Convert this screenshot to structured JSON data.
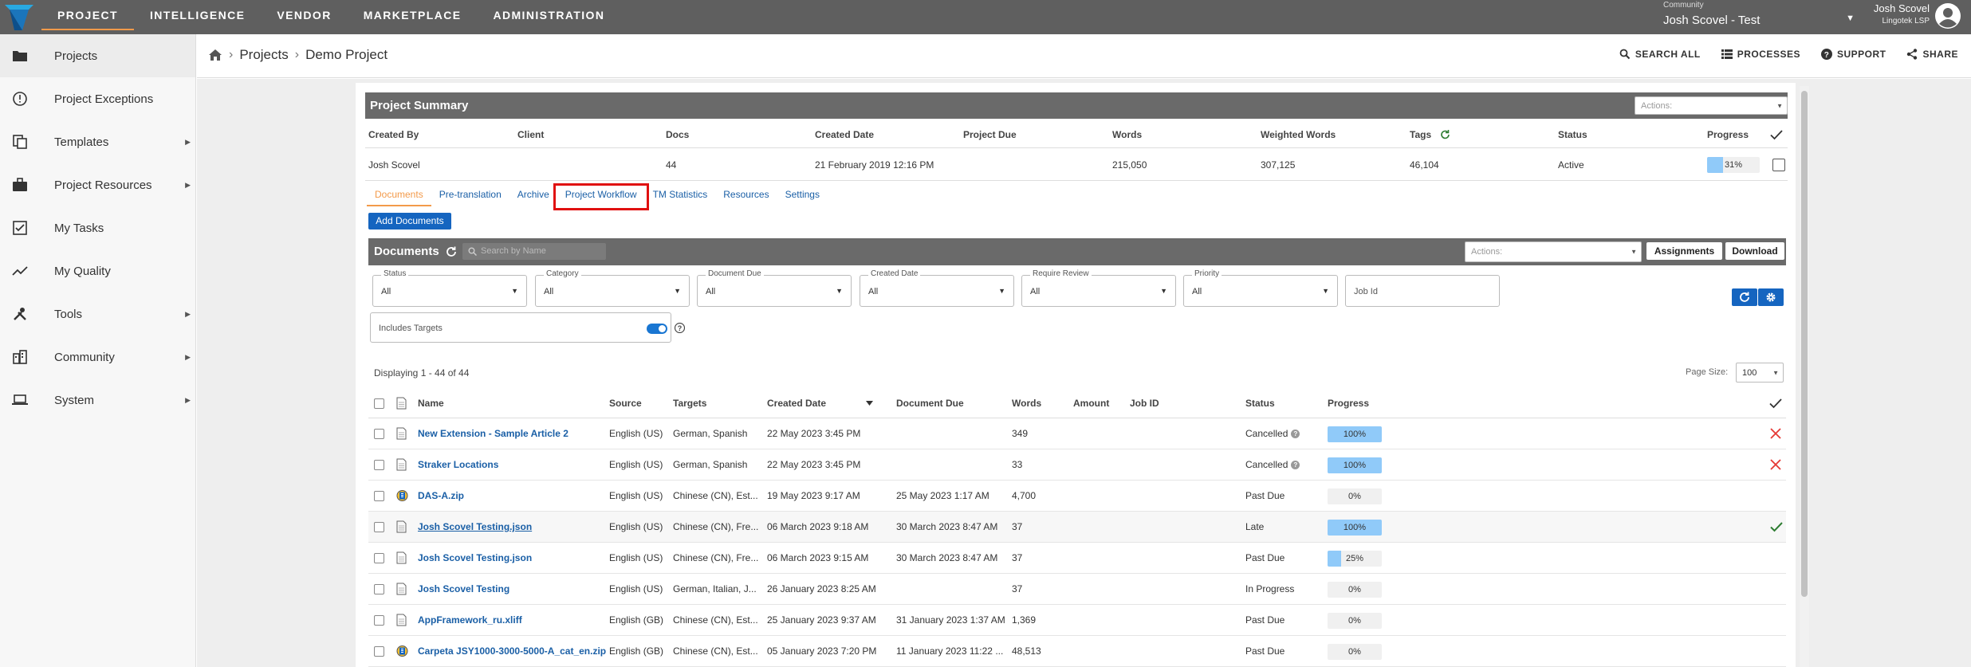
{
  "topnav": {
    "items": [
      "PROJECT",
      "INTELLIGENCE",
      "VENDOR",
      "MARKETPLACE",
      "ADMINISTRATION"
    ],
    "active_index": 0,
    "community_label": "Community",
    "community_value": "Josh Scovel - Test",
    "user_name": "Josh Scovel",
    "user_org": "Lingotek LSP"
  },
  "sidebar": {
    "items": [
      {
        "label": "Projects",
        "icon": "folder-icon",
        "has_submenu": false,
        "active": true
      },
      {
        "label": "Project Exceptions",
        "icon": "alert-circle-icon",
        "has_submenu": false
      },
      {
        "label": "Templates",
        "icon": "copy-icon",
        "has_submenu": true
      },
      {
        "label": "Project Resources",
        "icon": "briefcase-icon",
        "has_submenu": true
      },
      {
        "label": "My Tasks",
        "icon": "checkbox-icon",
        "has_submenu": false
      },
      {
        "label": "My Quality",
        "icon": "trend-line-icon",
        "has_submenu": false
      },
      {
        "label": "Tools",
        "icon": "tools-icon",
        "has_submenu": true
      },
      {
        "label": "Community",
        "icon": "buildings-icon",
        "has_submenu": true
      },
      {
        "label": "System",
        "icon": "laptop-icon",
        "has_submenu": true
      }
    ]
  },
  "breadcrumb": {
    "items": [
      "Projects",
      "Demo Project"
    ]
  },
  "header_actions": {
    "search_all": "SEARCH ALL",
    "processes": "PROCESSES",
    "support": "SUPPORT",
    "share": "SHARE"
  },
  "project_summary": {
    "title": "Project Summary",
    "actions_placeholder": "Actions:",
    "headers": [
      "Created By",
      "Client",
      "Docs",
      "Created Date",
      "Project Due",
      "Words",
      "Weighted Words",
      "Tags",
      "Status",
      "Progress"
    ],
    "row": {
      "created_by": "Josh Scovel",
      "client": "",
      "docs": "44",
      "created_date": "21 February 2019 12:16 PM",
      "project_due": "",
      "words": "215,050",
      "weighted_words": "307,125",
      "tags": "46,104",
      "status": "Active",
      "progress": "31%",
      "progress_value": 0.31
    }
  },
  "tabs": {
    "items": [
      "Documents",
      "Pre-translation",
      "Archive",
      "Project Workflow",
      "TM Statistics",
      "Resources",
      "Settings"
    ],
    "active_index": 0,
    "highlighted_index": 3
  },
  "add_documents_label": "Add Documents",
  "documents": {
    "title": "Documents",
    "search_placeholder": "Search by Name",
    "actions_placeholder": "Actions:",
    "assignments_label": "Assignments",
    "download_label": "Download",
    "filters": [
      {
        "label": "Status",
        "value": "All"
      },
      {
        "label": "Category",
        "value": "All"
      },
      {
        "label": "Document Due",
        "value": "All"
      },
      {
        "label": "Created Date",
        "value": "All"
      },
      {
        "label": "Require Review",
        "value": "All"
      },
      {
        "label": "Priority",
        "value": "All"
      }
    ],
    "job_id_placeholder": "Job Id",
    "includes_targets_label": "Includes Targets",
    "displaying": "Displaying 1 - 44 of 44",
    "page_size_label": "Page Size:",
    "page_size": "100",
    "columns": [
      "Name",
      "Source",
      "Targets",
      "Created Date",
      "Document Due",
      "Words",
      "Amount",
      "Job ID",
      "Status",
      "Progress"
    ],
    "rows": [
      {
        "name": "New Extension - Sample Article 2",
        "icon": "document-icon",
        "source": "English (US)",
        "targets": "German, Spanish",
        "created": "22 May 2023 3:45 PM",
        "due": "",
        "words": "349",
        "status": "Cancelled",
        "status_help": true,
        "progress": "100%",
        "progress_value": 1.0,
        "end": "close-x-icon"
      },
      {
        "name": "Straker Locations",
        "icon": "document-icon",
        "source": "English (US)",
        "targets": "German, Spanish",
        "created": "22 May 2023 3:45 PM",
        "due": "",
        "words": "33",
        "status": "Cancelled",
        "status_help": true,
        "progress": "100%",
        "progress_value": 1.0,
        "end": "close-x-icon"
      },
      {
        "name": "DAS-A.zip",
        "icon": "zip-file-icon",
        "source": "English (US)",
        "targets": "Chinese (CN), Est...",
        "created": "19 May 2023 9:17 AM",
        "due": "25 May 2023 1:17 AM",
        "words": "4,700",
        "status": "Past Due",
        "status_help": false,
        "progress": "0%",
        "progress_value": 0.0,
        "end": ""
      },
      {
        "name": "Josh Scovel Testing.json",
        "icon": "document-icon",
        "source": "English (US)",
        "targets": "Chinese (CN), Fre...",
        "created": "06 March 2023 9:18 AM",
        "due": "30 March 2023 8:47 AM",
        "words": "37",
        "status": "Late",
        "status_help": false,
        "progress": "100%",
        "progress_value": 1.0,
        "end": "check-icon",
        "underline": true,
        "shaded": true
      },
      {
        "name": "Josh Scovel Testing.json",
        "icon": "document-icon",
        "source": "English (US)",
        "targets": "Chinese (CN), Fre...",
        "created": "06 March 2023 9:15 AM",
        "due": "30 March 2023 8:47 AM",
        "words": "37",
        "status": "Past Due",
        "status_help": false,
        "progress": "25%",
        "progress_value": 0.25,
        "end": ""
      },
      {
        "name": "Josh Scovel Testing",
        "icon": "document-icon",
        "source": "English (US)",
        "targets": "German, Italian, J...",
        "created": "26 January 2023 8:25 AM",
        "due": "",
        "words": "37",
        "status": "In Progress",
        "status_help": false,
        "progress": "0%",
        "progress_value": 0.0,
        "end": ""
      },
      {
        "name": "AppFramework_ru.xliff",
        "icon": "document-icon",
        "source": "English (GB)",
        "targets": "Chinese (CN), Est...",
        "created": "25 January 2023 9:37 AM",
        "due": "31 January 2023 1:37 AM",
        "words": "1,369",
        "status": "Past Due",
        "status_help": false,
        "progress": "0%",
        "progress_value": 0.0,
        "end": ""
      },
      {
        "name": "Carpeta JSY1000-3000-5000-A_cat_en.zip",
        "icon": "zip-file-icon",
        "source": "English (GB)",
        "targets": "Chinese (CN), Est...",
        "created": "05 January 2023 7:20 PM",
        "due": "11 January 2023 11:22 ...",
        "words": "48,513",
        "status": "Past Due",
        "status_help": false,
        "progress": "0%",
        "progress_value": 0.0,
        "end": ""
      }
    ]
  },
  "colors": {
    "topbar": "#5f5f5f",
    "accent_orange": "#f39a4a",
    "link_blue": "#1a5fa6",
    "button_blue": "#1565c0",
    "progress_fill": "#90caf9",
    "highlight_red": "#e01010",
    "cancel_red": "#e53935",
    "check_green": "#2e7d32"
  }
}
